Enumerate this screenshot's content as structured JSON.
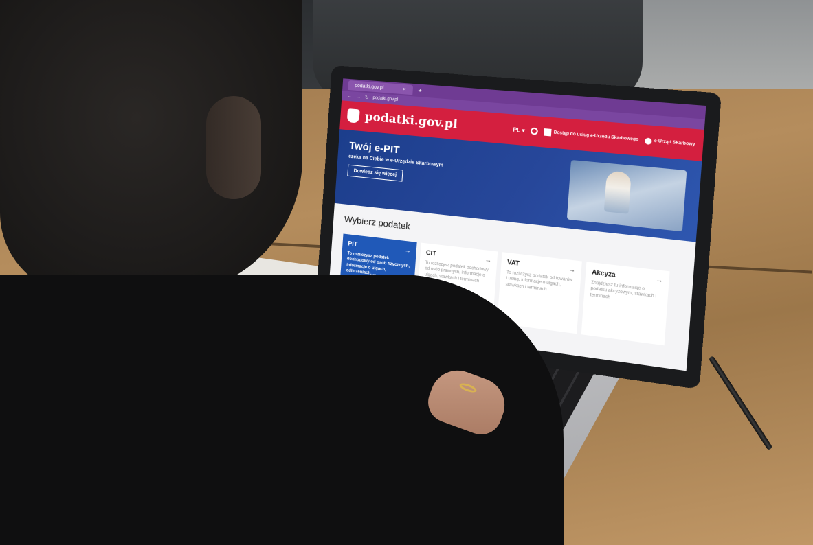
{
  "browser": {
    "tab_title": "podatki.gov.pl",
    "tab_close": "×",
    "tab_add": "+",
    "url": "podatki.gov.pl",
    "nav_icons": [
      "back-icon",
      "forward-icon",
      "reload-icon"
    ]
  },
  "site": {
    "logo_text": "podatki.gov.pl",
    "lang": "PL ▾",
    "header_link_1": "Dostęp do usług e-Urzędu Skarbowego",
    "header_link_2": "e-Urząd Skarbowy",
    "colors": {
      "header": "#d41f3f",
      "hero": "#1c3e8c",
      "active_card": "#2059b8",
      "tab_bar": "#6f3b93"
    }
  },
  "hero": {
    "title": "Twój e-PIT",
    "subtitle": "czeka na Ciebie w e-Urzędzie Skarbowym",
    "button": "Dowiedz się więcej"
  },
  "tax_section": {
    "title": "Wybierz podatek",
    "cards": [
      {
        "title": "PIT",
        "desc": "To rozliczysz podatek dochodowy od osób fizycznych, informacje o ulgach, odliczeniach, ...",
        "active": true
      },
      {
        "title": "CIT",
        "desc": "To rozliczysz podatek dochodowy od osób prawnych, informacje o ulgach, stawkach i terminach",
        "active": false
      },
      {
        "title": "VAT",
        "desc": "To rozliczysz podatek od towarów i usług, informacje o ulgach, stawkach i terminach",
        "active": false
      },
      {
        "title": "Akcyza",
        "desc": "Znajdziesz tu informacje o podatku akcyzowym, stawkach i terminach",
        "active": false
      }
    ]
  }
}
